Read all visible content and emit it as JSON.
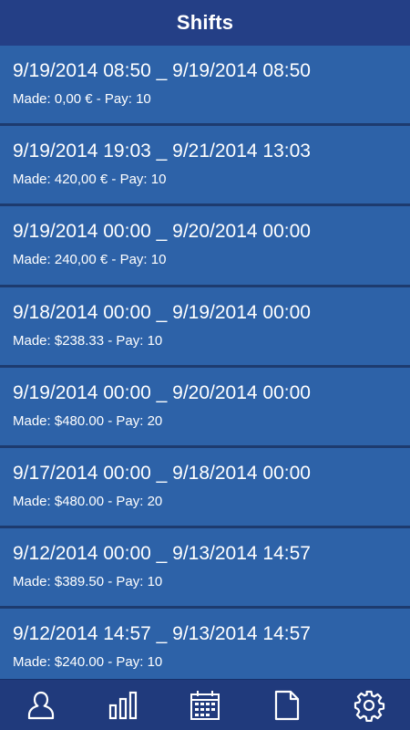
{
  "header": {
    "title": "Shifts"
  },
  "shifts": [
    {
      "range": "9/19/2014 08:50 _ 9/19/2014 08:50",
      "meta": "Made: 0,00 € - Pay: 10"
    },
    {
      "range": "9/19/2014 19:03 _ 9/21/2014 13:03",
      "meta": "Made: 420,00 € - Pay: 10"
    },
    {
      "range": "9/19/2014 00:00 _ 9/20/2014 00:00",
      "meta": "Made: 240,00 € - Pay: 10"
    },
    {
      "range": "9/18/2014 00:00 _ 9/19/2014 00:00",
      "meta": "Made: $238.33 - Pay: 10"
    },
    {
      "range": "9/19/2014 00:00 _ 9/20/2014 00:00",
      "meta": "Made: $480.00 - Pay: 20"
    },
    {
      "range": "9/17/2014 00:00 _ 9/18/2014 00:00",
      "meta": "Made: $480.00 - Pay: 20"
    },
    {
      "range": "9/12/2014 00:00 _ 9/13/2014 14:57",
      "meta": "Made: $389.50 - Pay: 10"
    },
    {
      "range": "9/12/2014 14:57 _ 9/13/2014 14:57",
      "meta": "Made: $240.00 - Pay: 10"
    }
  ],
  "bottom_nav": [
    {
      "icon": "user-icon"
    },
    {
      "icon": "bar-chart-icon"
    },
    {
      "icon": "calendar-icon"
    },
    {
      "icon": "document-icon"
    },
    {
      "icon": "gear-icon"
    }
  ],
  "colors": {
    "header_bg": "#243f86",
    "row_bg": "#2d62a8",
    "nav_bg": "#203a7c",
    "text": "#ffffff"
  }
}
